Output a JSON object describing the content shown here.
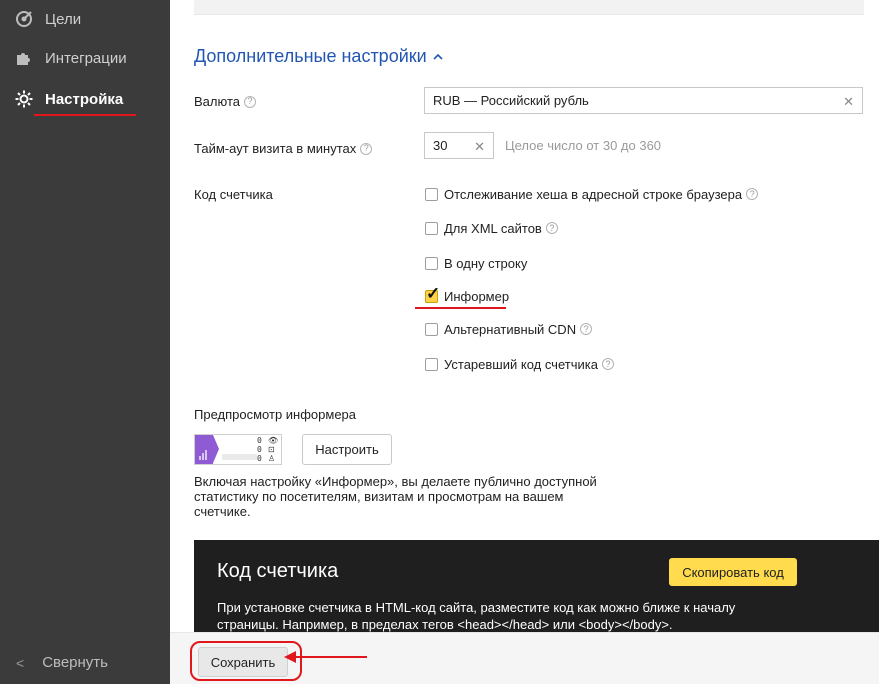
{
  "sidebar": {
    "items": [
      {
        "label": "Цели",
        "icon": "target-icon"
      },
      {
        "label": "Интеграции",
        "icon": "puzzle-icon"
      },
      {
        "label": "Настройка",
        "icon": "gear-icon",
        "active": true
      }
    ],
    "collapse_label": "Свернуть"
  },
  "settings": {
    "section_title": "Дополнительные настройки",
    "currency_label": "Валюта",
    "currency_value": "RUB — Российский рубль",
    "timeout_label": "Тайм-аут визита в минутах",
    "timeout_value": "30",
    "timeout_hint": "Целое число от 30 до 360",
    "code_label": "Код счетчика",
    "options": [
      {
        "label": "Отслеживание хеша в адресной строке браузера",
        "checked": false,
        "help": true
      },
      {
        "label": "Для XML сайтов",
        "checked": false,
        "help": true
      },
      {
        "label": "В одну строку",
        "checked": false,
        "help": false
      },
      {
        "label": "Информер",
        "checked": true,
        "help": false
      },
      {
        "label": "Альтернативный CDN",
        "checked": false,
        "help": true
      },
      {
        "label": "Устаревший код счетчика",
        "checked": false,
        "help": true
      }
    ],
    "preview_label": "Предпросмотр информера",
    "informer_values": [
      "0",
      "0",
      "0"
    ],
    "configure_button": "Настроить",
    "informer_description": "Включая настройку «Информер», вы делаете публично доступной статистику по посетителям, визитам и просмотрам на вашем счетчике."
  },
  "code_block": {
    "title": "Код счетчика",
    "copy_button": "Скопировать код",
    "text": "При установке счетчика в HTML-код сайта, разместите код как можно ближе к началу страницы. Например, в пределах тегов <head></head> или <body></body>."
  },
  "footer": {
    "save_button": "Сохранить"
  },
  "colors": {
    "sidebar_bg": "#3b3b3b",
    "accent_red": "#e0181e",
    "link_blue": "#2256b0",
    "yellow": "#ffdb4d",
    "informer_purple": "#8e5bd4"
  }
}
